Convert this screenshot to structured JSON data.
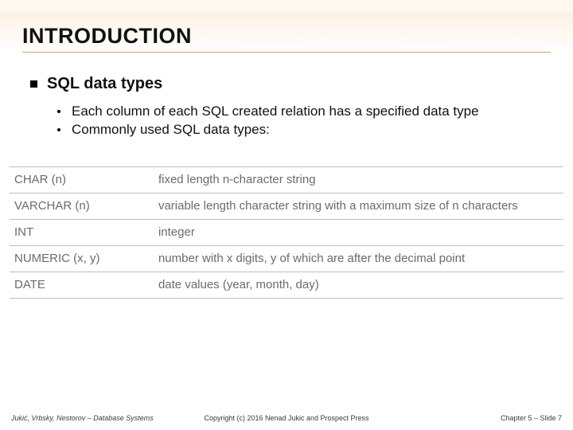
{
  "title": "INTRODUCTION",
  "heading": "SQL data types",
  "bullets": [
    "Each column of each SQL created relation has a specified data type",
    "Commonly used SQL data types:"
  ],
  "datatypes": [
    {
      "name": "CHAR (n)",
      "desc": "fixed length n-character string"
    },
    {
      "name": "VARCHAR (n)",
      "desc": "variable length character string with a maximum size of n characters"
    },
    {
      "name": "INT",
      "desc": "integer"
    },
    {
      "name": "NUMERIC (x, y)",
      "desc": "number with x digits, y of which are after the decimal point"
    },
    {
      "name": "DATE",
      "desc": "date values (year, month, day)"
    }
  ],
  "footer": {
    "left": "Jukić, Vrbsky, Nestorov – Database Systems",
    "center": "Copyright (c) 2016 Nenad Jukic and Prospect Press",
    "right": "Chapter 5 – Slide 7"
  }
}
